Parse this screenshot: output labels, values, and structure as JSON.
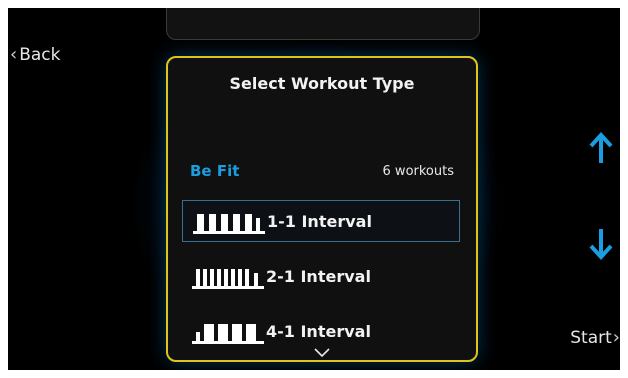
{
  "nav": {
    "back_label": "Back",
    "start_label": "Start"
  },
  "dialog": {
    "title": "Select Workout Type",
    "category": "Be Fit",
    "count": "6  workouts",
    "items": [
      {
        "label": "1-1 Interval",
        "selected": true,
        "icon": "interval-1-1-bars-icon"
      },
      {
        "label": "2-1 Interval",
        "selected": false,
        "icon": "interval-2-1-bars-icon"
      },
      {
        "label": "4-1 Interval",
        "selected": false,
        "icon": "interval-4-1-bars-icon"
      }
    ]
  },
  "icons": {
    "up": "arrow-up-icon",
    "down": "arrow-down-icon",
    "more": "chevron-down-icon"
  },
  "colors": {
    "accent_blue": "#1a9ee0",
    "dialog_border": "#e1c41a",
    "background": "#000000"
  }
}
